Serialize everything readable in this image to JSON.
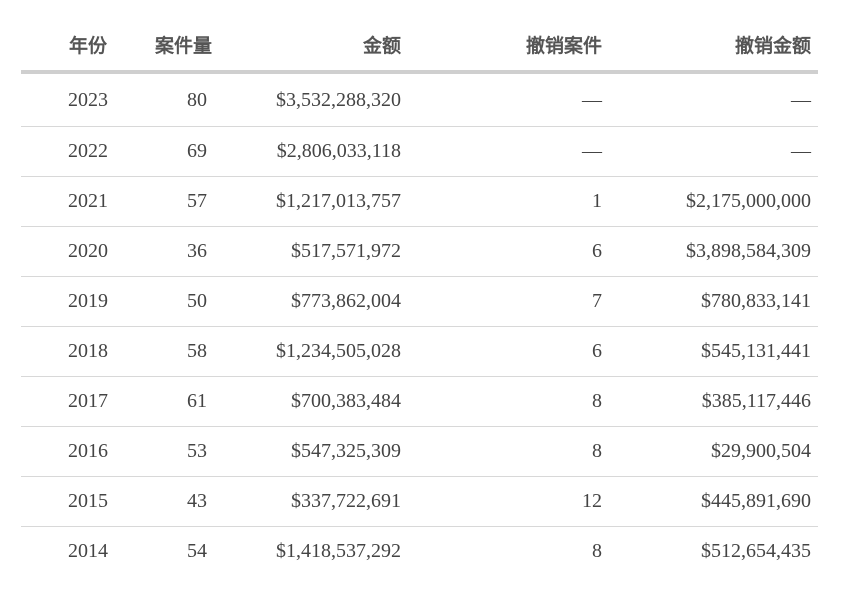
{
  "table": {
    "headers": {
      "year": "年份",
      "cases": "案件量",
      "amount": "金额",
      "revoked_cases": "撤销案件",
      "revoked_amount": "撤销金额"
    },
    "rows": [
      {
        "year": "2023",
        "cases": "80",
        "amount": "$3,532,288,320",
        "revoked_cases": "—",
        "revoked_amount": "—"
      },
      {
        "year": "2022",
        "cases": "69",
        "amount": "$2,806,033,118",
        "revoked_cases": "—",
        "revoked_amount": "—"
      },
      {
        "year": "2021",
        "cases": "57",
        "amount": "$1,217,013,757",
        "revoked_cases": "1",
        "revoked_amount": "$2,175,000,000"
      },
      {
        "year": "2020",
        "cases": "36",
        "amount": "$517,571,972",
        "revoked_cases": "6",
        "revoked_amount": "$3,898,584,309"
      },
      {
        "year": "2019",
        "cases": "50",
        "amount": "$773,862,004",
        "revoked_cases": "7",
        "revoked_amount": "$780,833,141"
      },
      {
        "year": "2018",
        "cases": "58",
        "amount": "$1,234,505,028",
        "revoked_cases": "6",
        "revoked_amount": "$545,131,441"
      },
      {
        "year": "2017",
        "cases": "61",
        "amount": "$700,383,484",
        "revoked_cases": "8",
        "revoked_amount": "$385,117,446"
      },
      {
        "year": "2016",
        "cases": "53",
        "amount": "$547,325,309",
        "revoked_cases": "8",
        "revoked_amount": "$29,900,504"
      },
      {
        "year": "2015",
        "cases": "43",
        "amount": "$337,722,691",
        "revoked_cases": "12",
        "revoked_amount": "$445,891,690"
      },
      {
        "year": "2014",
        "cases": "54",
        "amount": "$1,418,537,292",
        "revoked_cases": "8",
        "revoked_amount": "$512,654,435"
      }
    ]
  }
}
